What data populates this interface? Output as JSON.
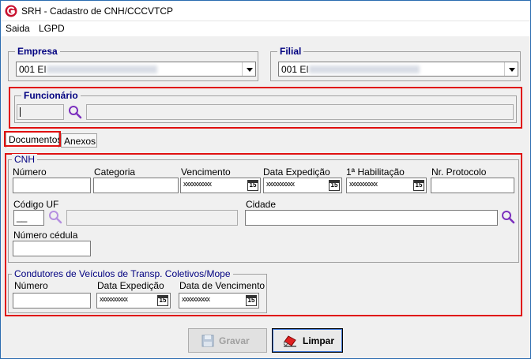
{
  "window": {
    "title": "SRH - Cadastro de CNH/CCCVTCP"
  },
  "menu": {
    "items": [
      "Saida",
      "LGPD"
    ]
  },
  "empresa": {
    "label": "Empresa",
    "value": "001 EI"
  },
  "filial": {
    "label": "Filial",
    "value": "001 EI"
  },
  "funcionario": {
    "label": "Funcionário"
  },
  "tabs": [
    {
      "label": "Documentos",
      "active": true
    },
    {
      "label": "Anexos",
      "active": false
    }
  ],
  "cnh": {
    "label": "CNH",
    "numero_label": "Número",
    "categoria_label": "Categoria",
    "vencimento_label": "Vencimento",
    "data_expedicao_label": "Data Expedição",
    "primeira_habilitacao_label": "1ª Habilitação",
    "nr_protocolo_label": "Nr. Protocolo",
    "codigo_uf_label": "Código UF",
    "codigo_uf_value": "__",
    "cidade_label": "Cidade",
    "numero_cedula_label": "Número cédula",
    "date_mask": "xxxxxxxxxx",
    "cal_day": "15"
  },
  "condutores": {
    "label": "Condutores de Veículos de Transp. Coletivos/Mope",
    "numero_label": "Número",
    "data_expedicao_label": "Data Expedição",
    "data_vencimento_label": "Data de Vencimento",
    "date_mask": "xxxxxxxxxx",
    "cal_day": "15"
  },
  "buttons": {
    "gravar": "Gravar",
    "limpar": "Limpar"
  },
  "colors": {
    "highlight": "#e01010",
    "group_label": "#000080",
    "search_icon": "#7b2fbe"
  }
}
